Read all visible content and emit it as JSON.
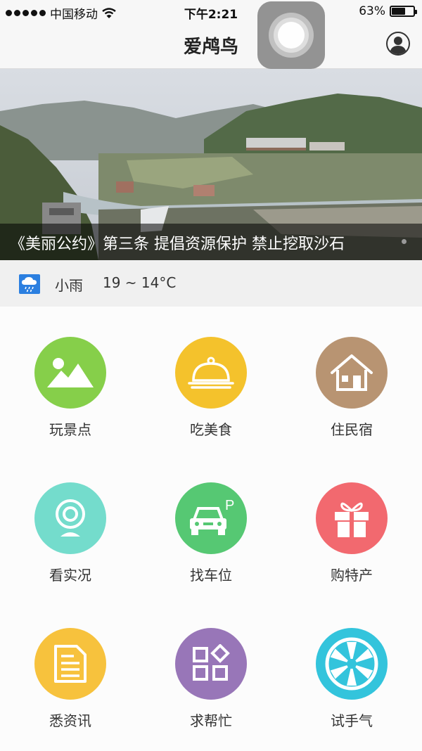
{
  "status_bar": {
    "carrier": "中国移动",
    "time": "下午2:21",
    "battery_text": "63%",
    "battery_level": 0.63
  },
  "nav": {
    "title": "爱鸬鸟"
  },
  "banner": {
    "caption": "《美丽公约》第三条 提倡资源保护 禁止挖取沙石"
  },
  "weather": {
    "condition": "小雨",
    "temperature": "19 ~ 14°C",
    "icon": "rain-cloud-icon"
  },
  "grid": {
    "items": [
      {
        "label": "玩景点",
        "icon": "landscape-icon",
        "color": "#86cf4a"
      },
      {
        "label": "吃美食",
        "icon": "food-cloche-icon",
        "color": "#f4c22c"
      },
      {
        "label": "住民宿",
        "icon": "house-icon",
        "color": "#b89472"
      },
      {
        "label": "看实况",
        "icon": "webcam-icon",
        "color": "#74dccc"
      },
      {
        "label": "找车位",
        "icon": "parking-car-icon",
        "color": "#56c873"
      },
      {
        "label": "购特产",
        "icon": "gift-icon",
        "color": "#f2696f"
      },
      {
        "label": "悉资讯",
        "icon": "document-icon",
        "color": "#f7c23d"
      },
      {
        "label": "求帮忙",
        "icon": "apps-grid-icon",
        "color": "#9876b8"
      },
      {
        "label": "试手气",
        "icon": "wheel-icon",
        "color": "#33c4dc"
      }
    ]
  }
}
